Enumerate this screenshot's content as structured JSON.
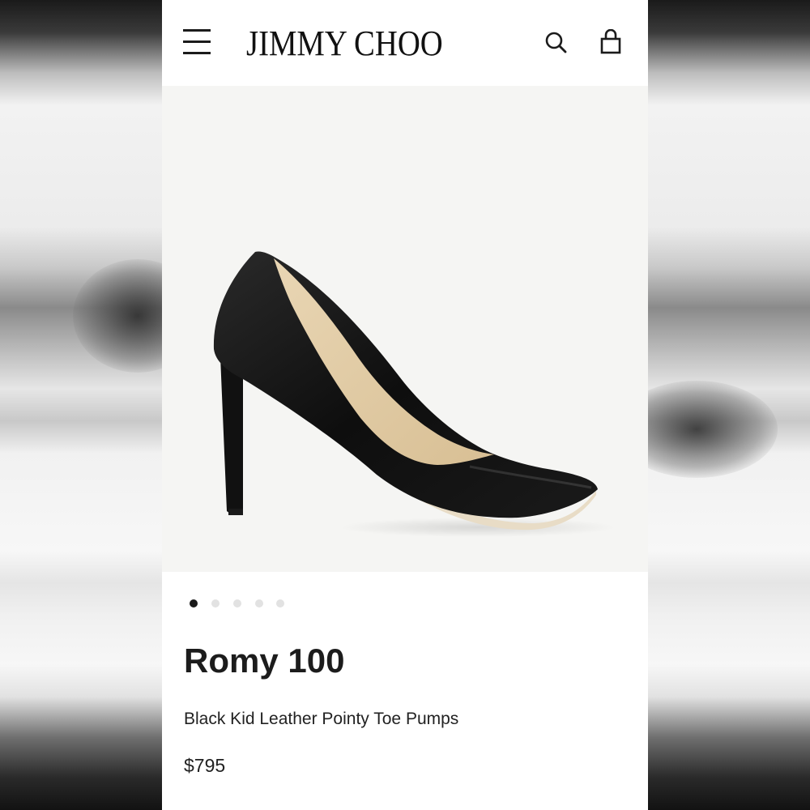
{
  "header": {
    "brand": "JIMMY CHOO",
    "menu_icon": "hamburger-menu-icon",
    "search_icon": "search-icon",
    "bag_icon": "shopping-bag-icon"
  },
  "gallery": {
    "image": "black-pointy-toe-pump-image",
    "slide_count": 5,
    "active_slide": 1
  },
  "product": {
    "name": "Romy 100",
    "description": "Black Kid Leather Pointy Toe Pumps",
    "price": "$795"
  },
  "colors": {
    "text": "#1c1c1c",
    "image_bg": "#f5f5f3",
    "active_dot": "#1a1a1a",
    "inactive_dot": "#e2e2e2"
  }
}
